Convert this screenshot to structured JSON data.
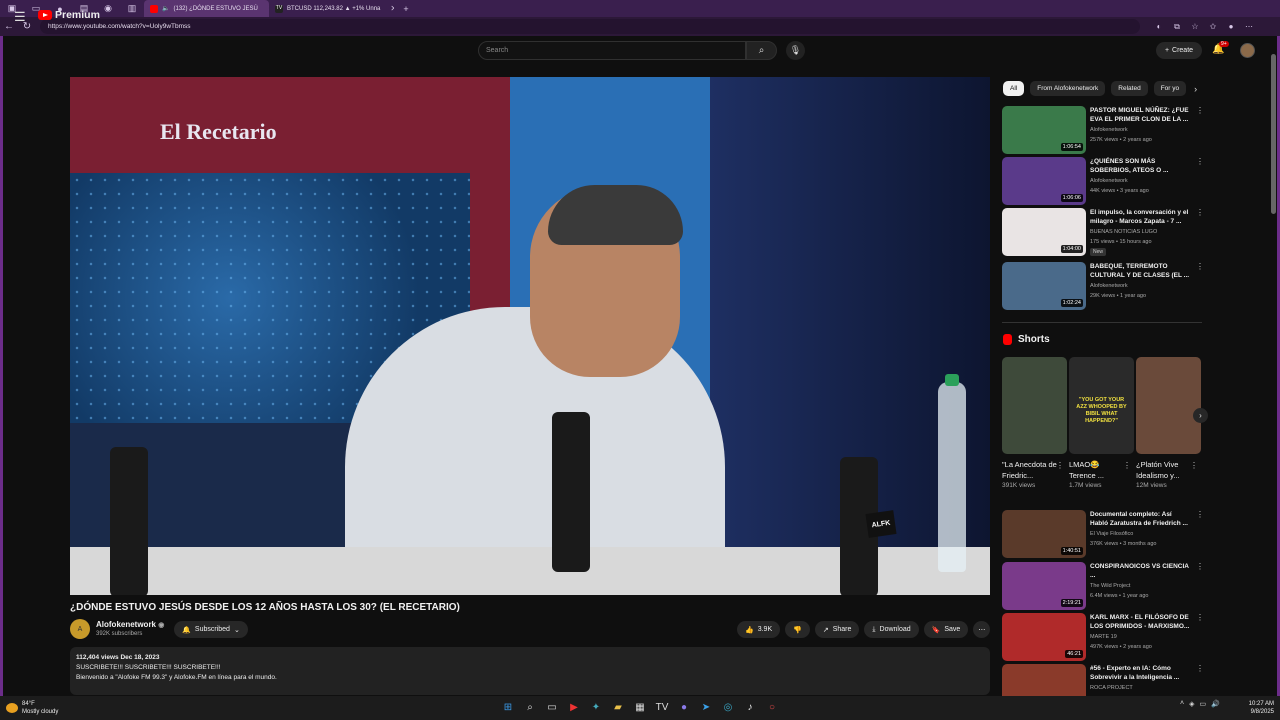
{
  "browser": {
    "tabs": [
      {
        "label": "(132) ¿DÓNDE ESTUVO JESÚ",
        "active": true
      },
      {
        "label": "BTCUSD 112,243.82 ▲ +1% Unna",
        "active": false
      }
    ],
    "url": "https://www.youtube.com/watch?v=Uoly9wTbmss"
  },
  "header": {
    "logo_text": "Premium",
    "search_placeholder": "Search",
    "create_label": "Create",
    "notif_count": "9+"
  },
  "video": {
    "overlay_logo": "El Recetario",
    "title": "¿DÓNDE ESTUVO JESÚS DESDE LOS 12 AÑOS HASTA LOS 30? (EL RECETARIO)",
    "channel": "Alofokenetwork",
    "subscribers": "392K subscribers",
    "subscribe_label": "Subscribed",
    "likes": "3.9K",
    "share_label": "Share",
    "download_label": "Download",
    "save_label": "Save",
    "meta": "112,404 views  Dec 18, 2023",
    "desc_line1": "SUSCRIBETE!!! SUSCRIBETE!!! SUSCRIBETE!!!",
    "desc_line2": "Bienvenido a \"Alofoke FM 99.3\" y Alofoke.FM en línea para el mundo."
  },
  "chips": [
    "All",
    "From Alofokenetwork",
    "Related",
    "For yo"
  ],
  "recommended_top": [
    {
      "title": "PASTOR MIGUEL NÚÑEZ: ¿FUE EVA EL PRIMER CLON DE LA ...",
      "channel": "Alofokenetwork",
      "views": "257K views • 2 years ago",
      "duration": "1:06:54",
      "color": "#3a7a4a"
    },
    {
      "title": "¿QUIÉNES SON MÁS SOBERBIOS, ATEOS O ...",
      "channel": "Alofokenetwork",
      "views": "44K views • 3 years ago",
      "duration": "1:06:06",
      "color": "#5a3a8a"
    },
    {
      "title": "El impulso, la conversación y el milagro - Marcos Zapata - 7 ...",
      "channel": "BUENAS NOTICIAS LUGO",
      "views": "175 views • 15 hours ago",
      "duration": "1:04:00",
      "badge": "New",
      "color": "#e9e4e4"
    },
    {
      "title": "BABEQUE, TERREMOTO CULTURAL Y DE CLASES (EL ...",
      "channel": "Alofokenetwork",
      "views": "29K views • 1 year ago",
      "duration": "1:02:24",
      "color": "#4a6a8a"
    }
  ],
  "shorts": {
    "heading": "Shorts",
    "items": [
      {
        "title": "\"La Anecdota de Friedric...",
        "views": "391K views",
        "color": "#3e4a3a"
      },
      {
        "title": "LMAO😂 Terence ...",
        "views": "1.7M views",
        "color": "#2a2a2a",
        "caption": "\"YOU GOT YOUR AZZ WHOOPED BY BIBIL WHAT HAPPEND?\""
      },
      {
        "title": "¿Platón Vive Idealismo y...",
        "views": "12M views",
        "color": "#6a4a3a"
      }
    ]
  },
  "recommended_bottom": [
    {
      "title": "Documental completo: Así Habló Zaratustra de Friedrich ...",
      "channel": "El Viaje Filosófico",
      "views": "376K views • 3 months ago",
      "duration": "1:40:51",
      "color": "#5a3a2a"
    },
    {
      "title": "CONSPIRANOICOS VS CIENCIA ...",
      "channel": "The Wild Project",
      "views": "6.4M views • 1 year ago",
      "duration": "2:19:21",
      "color": "#7a3a8a"
    },
    {
      "title": "KARL MARX - EL FILÓSOFO DE LOS OPRIMIDOS - MARXISMO...",
      "channel": "MARTE 19",
      "views": "497K views • 2 years ago",
      "duration": "46:21",
      "color": "#b02a2a"
    },
    {
      "title": "#56 - Experto en IA: Cómo Sobrevivir a la Inteligencia ...",
      "channel": "ROCA PROJECT",
      "views": "",
      "duration": "",
      "color": "#8a3a2a"
    }
  ],
  "taskbar": {
    "temp": "84°F",
    "weather": "Mostly cloudy",
    "time": "10:27 AM",
    "date": "9/8/2025"
  }
}
